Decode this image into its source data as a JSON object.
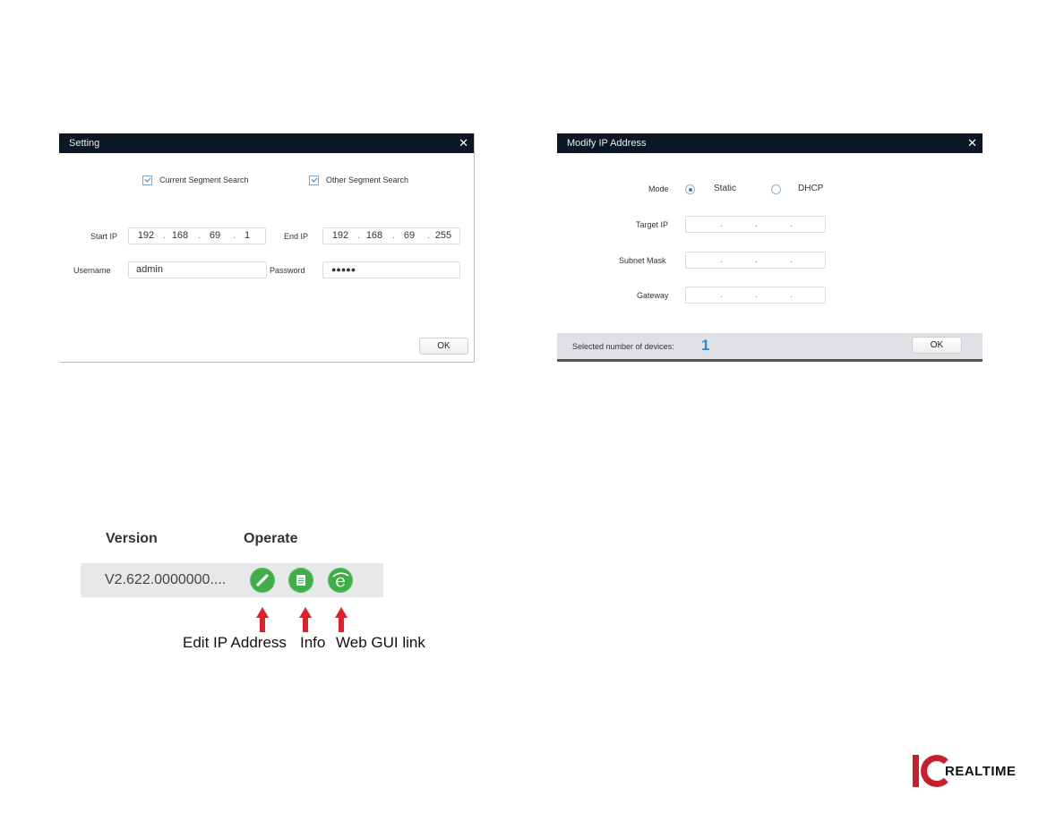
{
  "setting_dialog": {
    "title": "Setting",
    "close_icon": "close-icon",
    "current_segment": {
      "label": "Current Segment Search",
      "checked": true
    },
    "other_segment": {
      "label": "Other Segment Search",
      "checked": true
    },
    "start_ip": {
      "label": "Start IP",
      "octets": [
        "192",
        "168",
        "69",
        "1"
      ]
    },
    "end_ip": {
      "label": "End IP",
      "octets": [
        "192",
        "168",
        "69",
        "255"
      ]
    },
    "username": {
      "label": "Username",
      "value": "admin"
    },
    "password": {
      "label": "Password",
      "value": "●●●●●"
    },
    "ok_label": "OK"
  },
  "modify_dialog": {
    "title": "Modify IP Address",
    "close_icon": "close-icon",
    "mode": {
      "label": "Mode",
      "options": [
        "Static",
        "DHCP"
      ],
      "selected": "Static"
    },
    "target_ip": {
      "label": "Target IP",
      "octets": [
        "",
        "",
        "",
        ""
      ]
    },
    "subnet_mask": {
      "label": "Subnet Mask",
      "octets": [
        "",
        "",
        "",
        ""
      ]
    },
    "gateway": {
      "label": "Gateway",
      "octets": [
        "",
        "",
        "",
        ""
      ]
    },
    "footer": {
      "label": "Selected number of devices:",
      "count": "1"
    },
    "ok_label": "OK"
  },
  "device_table": {
    "headers": [
      "Version",
      "Operate"
    ],
    "row": {
      "version": "V2.622.0000000....",
      "operations": [
        "edit-ip-icon",
        "info-icon",
        "web-gui-icon"
      ]
    },
    "captions": [
      "Edit IP Address",
      "Info",
      "Web GUI link"
    ]
  },
  "logo": {
    "mark": "IC",
    "text": "REALTIME",
    "brand_color": "#c8202a"
  },
  "colors": {
    "titlebar": "#0d1625",
    "operate_green": "#3fae49",
    "arrow_red": "#e2202a",
    "count_blue": "#2b8ad8"
  }
}
